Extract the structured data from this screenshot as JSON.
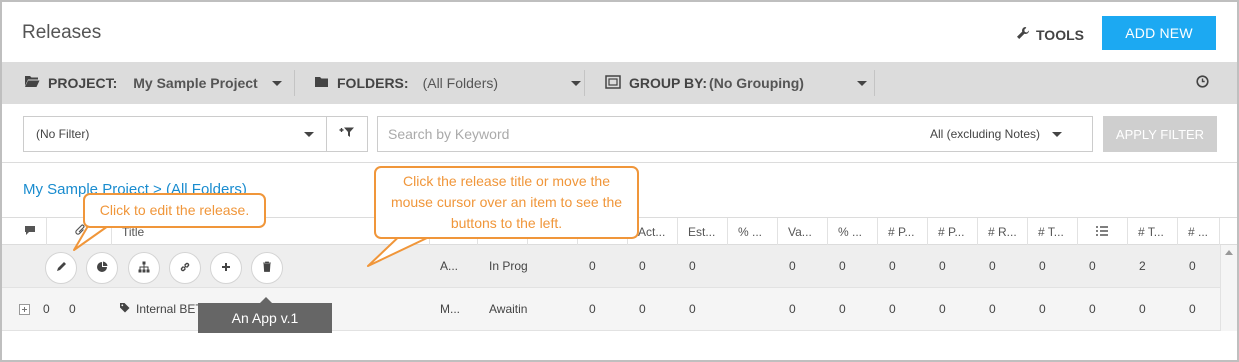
{
  "header": {
    "title": "Releases",
    "tools_label": "TOOLS",
    "add_new_label": "ADD NEW"
  },
  "toolbar": {
    "project_label": "PROJECT:",
    "project_value": "My Sample Project",
    "folders_label": "FOLDERS:",
    "folders_value": "(All Folders)",
    "group_label": "GROUP BY:",
    "group_value": "(No Grouping)"
  },
  "search": {
    "filter_value": "(No Filter)",
    "placeholder": "Search by Keyword",
    "scope_value": "All (excluding Notes)",
    "apply_label": "APPLY FILTER"
  },
  "breadcrumb": "My Sample Project > (All Folders)",
  "grid": {
    "headers": [
      "Title",
      "Act...",
      "Est...",
      "% ...",
      "Va...",
      "% ...",
      "# P...",
      "# P...",
      "# R...",
      "# T...",
      "# T...",
      "# ..."
    ],
    "row1": {
      "c1": "A...",
      "status": "In Prog",
      "values": [
        "0",
        "0",
        "0",
        "0",
        "0",
        "0",
        "0",
        "0",
        "0",
        "0",
        "2",
        "0"
      ]
    },
    "row2": {
      "n1": "0",
      "n2": "0",
      "title": "Internal BETA Release",
      "c1": "M...",
      "status": "Awaitin",
      "values": [
        "0",
        "0",
        "0",
        "0",
        "0",
        "0",
        "0",
        "0",
        "0",
        "0",
        "0",
        "0"
      ]
    }
  },
  "tooltip": "An App v.1",
  "callouts": {
    "edit": "Click to edit the release.",
    "hover": "Click the release title or move the mouse cursor over an item to see the buttons to the left."
  }
}
